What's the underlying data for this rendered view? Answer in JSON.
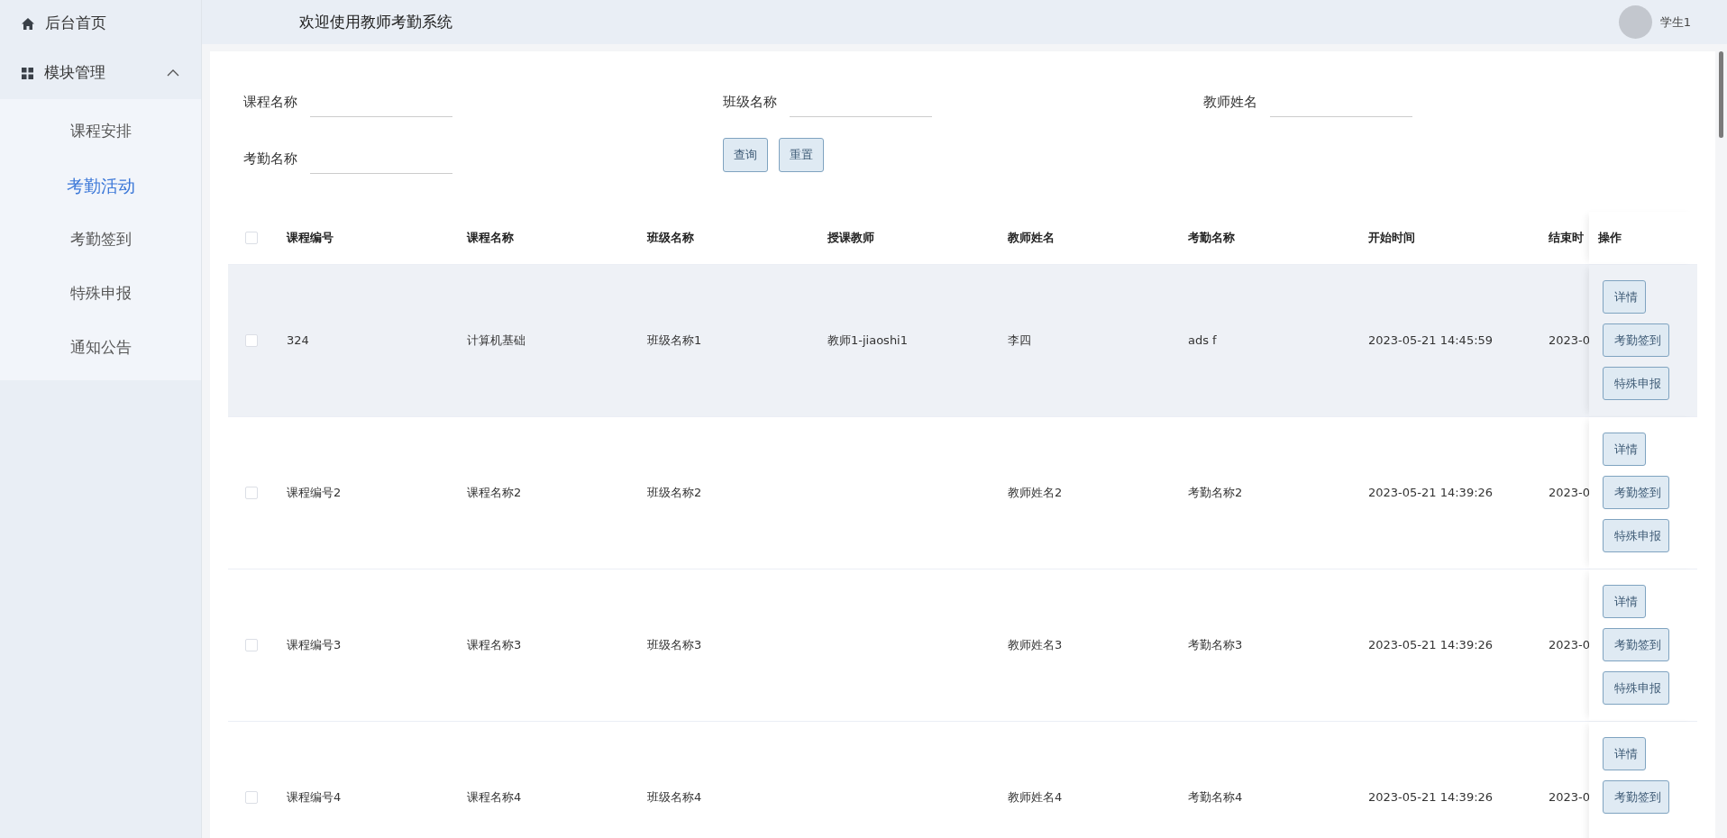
{
  "sidebar": {
    "items": [
      {
        "label": "后台首页"
      },
      {
        "label": "模块管理",
        "expanded": true,
        "children": [
          {
            "label": "课程安排",
            "selected": false
          },
          {
            "label": "考勤活动",
            "selected": true
          },
          {
            "label": "考勤签到",
            "selected": false
          },
          {
            "label": "特殊申报",
            "selected": false
          },
          {
            "label": "通知公告",
            "selected": false
          }
        ]
      }
    ]
  },
  "header": {
    "title": "欢迎使用教师考勤系统",
    "user": "学生1"
  },
  "search": {
    "fields": [
      {
        "label": "课程名称"
      },
      {
        "label": "班级名称"
      },
      {
        "label": "教师姓名"
      },
      {
        "label": "考勤名称"
      }
    ],
    "buttons": [
      "查询",
      "重置"
    ]
  },
  "table": {
    "header_checked": false,
    "columns": [
      "课程编号",
      "课程名称",
      "班级名称",
      "授课教师",
      "教师姓名",
      "考勤名称",
      "开始时间",
      "结束时"
    ],
    "action_column": "操作",
    "rows": [
      {
        "checked": false,
        "highlighted": true,
        "cells": [
          "324",
          "计算机基础",
          "班级名称1",
          "教师1-jiaoshi1",
          "李四",
          "ads f",
          "2023-05-21 14:45:59",
          "2023-0"
        ],
        "actions": [
          "详情",
          "考勤签到",
          "特殊申报"
        ]
      },
      {
        "checked": false,
        "highlighted": false,
        "cells": [
          "课程编号2",
          "课程名称2",
          "班级名称2",
          "",
          "教师姓名2",
          "考勤名称2",
          "2023-05-21 14:39:26",
          "2023-0"
        ],
        "actions": [
          "详情",
          "考勤签到",
          "特殊申报"
        ]
      },
      {
        "checked": false,
        "highlighted": false,
        "cells": [
          "课程编号3",
          "课程名称3",
          "班级名称3",
          "",
          "教师姓名3",
          "考勤名称3",
          "2023-05-21 14:39:26",
          "2023-0"
        ],
        "actions": [
          "详情",
          "考勤签到",
          "特殊申报"
        ]
      },
      {
        "checked": false,
        "highlighted": false,
        "cells": [
          "课程编号4",
          "课程名称4",
          "班级名称4",
          "",
          "教师姓名4",
          "考勤名称4",
          "2023-05-21 14:39:26",
          "2023-0"
        ],
        "actions": [
          "详情",
          "考勤签到"
        ]
      }
    ]
  }
}
